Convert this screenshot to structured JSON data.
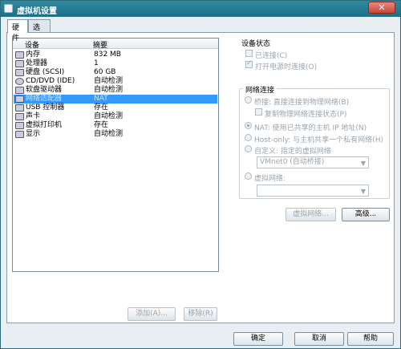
{
  "window": {
    "title": "虚拟机设置",
    "close_glyph": "✕"
  },
  "tabs": [
    {
      "label": "硬件"
    },
    {
      "label": "选项"
    }
  ],
  "device_list": {
    "columns": {
      "device": "设备",
      "summary": "摘要"
    },
    "rows": [
      {
        "name": "内存",
        "summary": "832 MB",
        "icon": "memory-icon"
      },
      {
        "name": "处理器",
        "summary": "1",
        "icon": "processor-icon"
      },
      {
        "name": "硬盘 (SCSI)",
        "summary": "60 GB",
        "icon": "hard-disk-icon"
      },
      {
        "name": "CD/DVD (IDE)",
        "summary": "自动检测",
        "icon": "cd-dvd-icon"
      },
      {
        "name": "软盘驱动器",
        "summary": "自动检测",
        "icon": "floppy-icon"
      },
      {
        "name": "网络适配器",
        "summary": "NAT",
        "icon": "network-adapter-icon",
        "selected": true
      },
      {
        "name": "USB 控制器",
        "summary": "存在",
        "icon": "usb-icon"
      },
      {
        "name": "声卡",
        "summary": "自动检测",
        "icon": "sound-card-icon"
      },
      {
        "name": "虚拟打印机",
        "summary": "存在",
        "icon": "printer-icon"
      },
      {
        "name": "显示",
        "summary": "自动检测",
        "icon": "display-icon"
      }
    ],
    "add_label": "添加(A)...",
    "remove_label": "移除(R)"
  },
  "device_status": {
    "title": "设备状态",
    "connected": "已连接(C)",
    "connect_at_power_on": "打开电源时连接(O)"
  },
  "network_connection": {
    "title": "网络连接",
    "bridged": "桥接: 直接连接到物理网络(B)",
    "replicate": "复制物理网络连接状态(P)",
    "nat": "NAT: 使用已共享的主机 IP 地址(N)",
    "host_only": "Host-only: 与主机共享一个私有网络(H)",
    "custom": "自定义: 指定的虚拟网络",
    "custom_value": "VMnet0 (自动桥接)",
    "lan_segment": "虚拟网络:",
    "lan_value": ""
  },
  "panel_buttons": {
    "virtual_network": "虚拟网络...",
    "advanced": "高级..."
  },
  "footer": {
    "ok": "确定",
    "cancel": "取消",
    "help": "帮助"
  }
}
